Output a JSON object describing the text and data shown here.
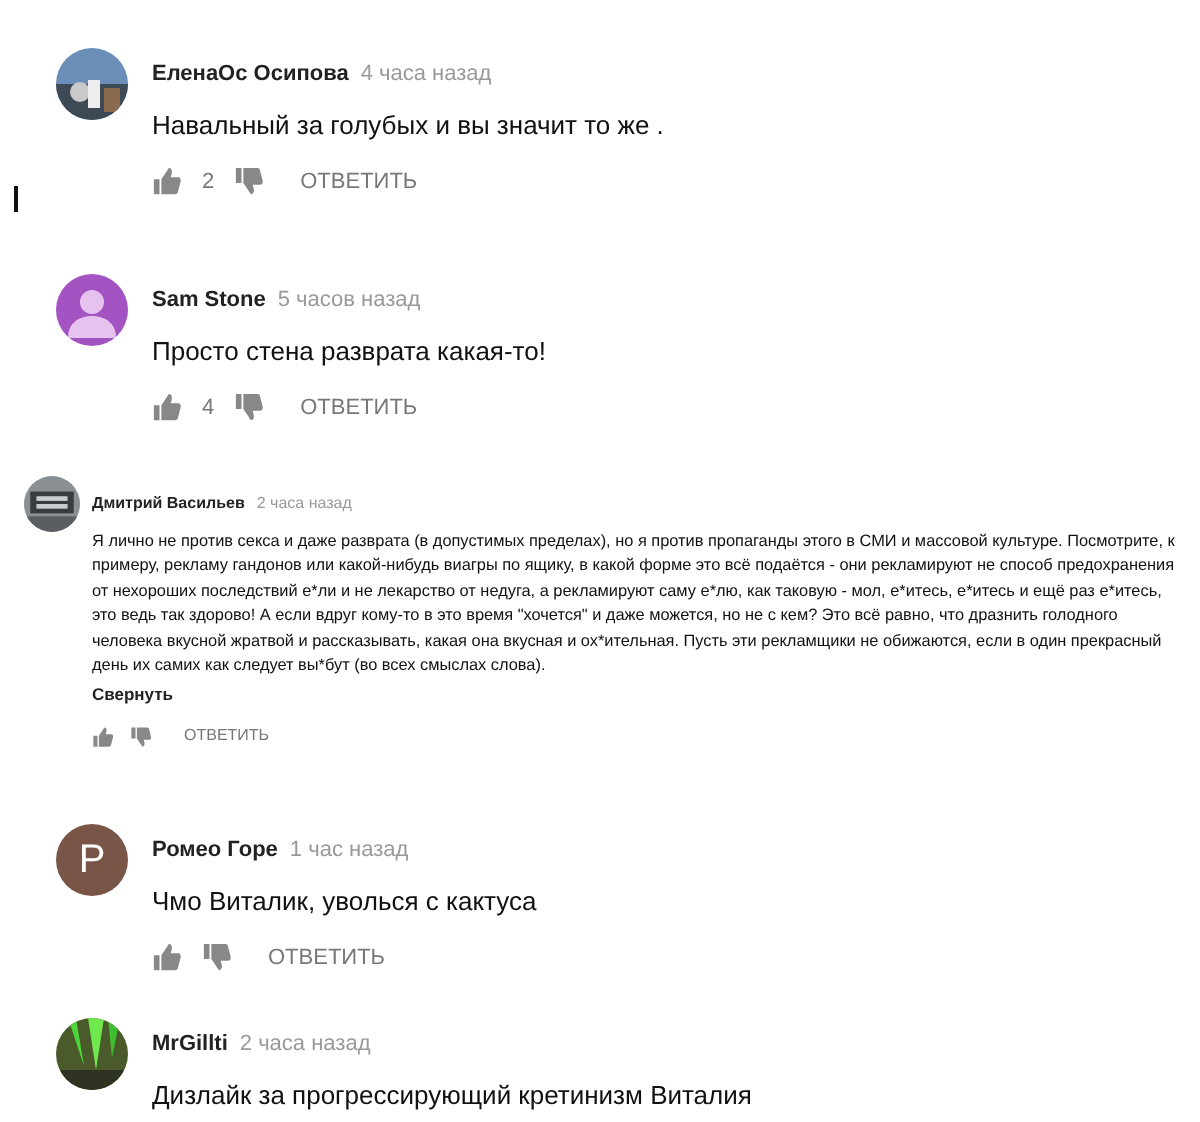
{
  "comments": [
    {
      "author": "ЕленаОс Осипова",
      "time": "4 часа назад",
      "text": "Навальный за голубых и вы значит то же .",
      "likes": "2",
      "reply": "ОТВЕТИТЬ",
      "compact": false
    },
    {
      "author": "Sam Stone",
      "time": "5 часов назад",
      "text": "Просто стена разврата какая-то!",
      "likes": "4",
      "reply": "ОТВЕТИТЬ",
      "compact": false,
      "avatar": {
        "kind": "person",
        "color": "#a453c2"
      }
    },
    {
      "author": "Дмитрий Васильев",
      "time": "2 часа назад",
      "text": "Я лично не против секса и даже разврата (в допустимых пределах), но я против пропаганды этого в СМИ и массовой культуре. Посмотрите, к примеру, рекламу гандонов или какой-нибудь виагры по ящику, в какой форме это всё подаётся - они рекламируют не способ предохранения от нехороших последствий е*ли и не лекарство от недуга, а рекламируют саму е*лю, как таковую - мол, е*итесь, е*итесь и ещё раз е*итесь, это ведь так здорово! А если вдруг кому-то в это время \"хочется\" и даже можется, но не с кем? Это всё равно, что дразнить голодного человека вкусной жратвой и рассказывать, какая она вкусная и ох*ительная. Пусть эти рекламщики не обижаются, если в один прекрасный день их самих как следует вы*бут (во всех смыслах слова).",
      "collapse": "Свернуть",
      "reply": "ОТВЕТИТЬ",
      "compact": true
    },
    {
      "author": "Ромео Горе",
      "time": "1 час назад",
      "text": "Чмо Виталик, уволься с кактуса",
      "reply": "ОТВЕТИТЬ",
      "compact": false,
      "avatar": {
        "kind": "letter",
        "letter": "P",
        "color": "#795548"
      }
    },
    {
      "author": "MrGillti",
      "time": "2 часа назад",
      "text": "Дизлайк за прогрессирующий кретинизм Виталия",
      "compact": false
    }
  ]
}
